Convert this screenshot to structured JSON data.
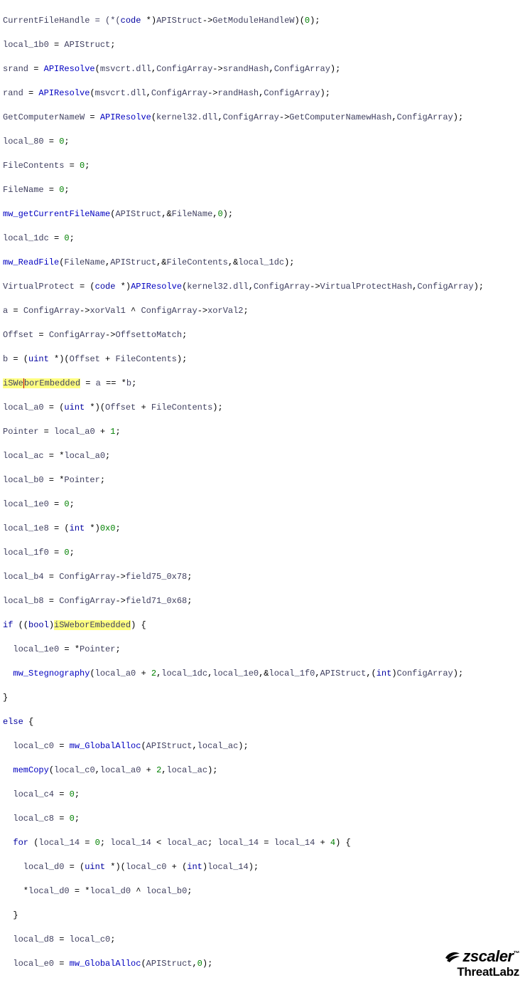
{
  "code": {
    "l1": {
      "a": "CurrentFileHandle = (*(",
      "b": "code",
      "c": " *)",
      "d": "APIStruct",
      "e": "->",
      "f": "GetModuleHandleW",
      "g": ")(",
      "h": "0",
      "i": ");"
    },
    "l2": {
      "a": "local_1b0",
      "b": " = ",
      "c": "APIStruct",
      "d": ";"
    },
    "l3": {
      "a": "srand",
      "b": " = ",
      "c": "APIResolve",
      "d": "(",
      "e": "msvcrt.dll",
      "f": ",",
      "g": "ConfigArray",
      "h": "->",
      "i": "srandHash",
      "j": ",",
      "k": "ConfigArray",
      "l": ");"
    },
    "l4": {
      "a": "rand",
      "b": " = ",
      "c": "APIResolve",
      "d": "(",
      "e": "msvcrt.dll",
      "f": ",",
      "g": "ConfigArray",
      "h": "->",
      "i": "randHash",
      "j": ",",
      "k": "ConfigArray",
      "l": ");"
    },
    "l5": {
      "a": "GetComputerNameW",
      "b": " = ",
      "c": "APIResolve",
      "d": "(",
      "e": "kernel32.dll",
      "f": ",",
      "g": "ConfigArray",
      "h": "->",
      "i": "GetComputerNamewHash",
      "j": ",",
      "k": "ConfigArray",
      "l": ");"
    },
    "l6": {
      "a": "local_80",
      "b": " = ",
      "c": "0",
      "d": ";"
    },
    "l7": {
      "a": "FileContents",
      "b": " = ",
      "c": "0",
      "d": ";"
    },
    "l8": {
      "a": "FileName",
      "b": " = ",
      "c": "0",
      "d": ";"
    },
    "l9": {
      "a": "mw_getCurrentFileName",
      "b": "(",
      "c": "APIStruct",
      "d": ",&",
      "e": "FileName",
      "f": ",",
      "g": "0",
      "h": ");"
    },
    "l10": {
      "a": "local_1dc",
      "b": " = ",
      "c": "0",
      "d": ";"
    },
    "l11": {
      "a": "mw_ReadFile",
      "b": "(",
      "c": "FileName",
      "d": ",",
      "e": "APIStruct",
      "f": ",&",
      "g": "FileContents",
      "h": ",&",
      "i": "local_1dc",
      "j": ");"
    },
    "l12": {
      "a": "VirtualProtect",
      "b": " = (",
      "c": "code",
      "d": " *)",
      "e": "APIResolve",
      "f": "(",
      "g": "kernel32.dll",
      "h": ",",
      "i": "ConfigArray",
      "j": "->",
      "k": "VirtualProtectHash",
      "l": ",",
      "m": "ConfigArray",
      "n": ");"
    },
    "l13": {
      "a": "a",
      "b": " = ",
      "c": "ConfigArray",
      "d": "->",
      "e": "xorVal1",
      "f": " ^ ",
      "g": "ConfigArray",
      "h": "->",
      "i": "xorVal2",
      "j": ";"
    },
    "l14": {
      "a": "Offset",
      "b": " = ",
      "c": "ConfigArray",
      "d": "->",
      "e": "OffsettoMatch",
      "f": ";"
    },
    "l15": {
      "a": "b",
      "b": " = (",
      "c": "uint",
      "d": " *)(",
      "e": "Offset",
      "f": " + ",
      "g": "FileContents",
      "h": ");"
    },
    "l16": {
      "a": "iSWe",
      "b": "borEmbedded",
      "c": " = ",
      "d": "a",
      "e": " == *",
      "f": "b",
      "g": ";"
    },
    "l17": {
      "a": "local_a0",
      "b": " = (",
      "c": "uint",
      "d": " *)(",
      "e": "Offset",
      "f": " + ",
      "g": "FileContents",
      "h": ");"
    },
    "l18": {
      "a": "Pointer",
      "b": " = ",
      "c": "local_a0",
      "d": " + ",
      "e": "1",
      "f": ";"
    },
    "l19": {
      "a": "local_ac",
      "b": " = *",
      "c": "local_a0",
      "d": ";"
    },
    "l20": {
      "a": "local_b0",
      "b": " = *",
      "c": "Pointer",
      "d": ";"
    },
    "l21": {
      "a": "local_1e0",
      "b": " = ",
      "c": "0",
      "d": ";"
    },
    "l22": {
      "a": "local_1e8",
      "b": " = (",
      "c": "int",
      "d": " *)",
      "e": "0x0",
      "f": ";"
    },
    "l23": {
      "a": "local_1f0",
      "b": " = ",
      "c": "0",
      "d": ";"
    },
    "l24": {
      "a": "local_b4",
      "b": " = ",
      "c": "ConfigArray",
      "d": "->",
      "e": "field75_0x78",
      "f": ";"
    },
    "l25": {
      "a": "local_b8",
      "b": " = ",
      "c": "ConfigArray",
      "d": "->",
      "e": "field71_0x68",
      "f": ";"
    },
    "l26": {
      "a": "if",
      "b": " ((",
      "c": "bool",
      "d": ")",
      "e": "iSWeborEmbedded",
      "f": ") {"
    },
    "l27": {
      "a": "  local_1e0",
      "b": " = *",
      "c": "Pointer",
      "d": ";"
    },
    "l28": {
      "a": "  ",
      "b": "mw_Stegnography",
      "c": "(",
      "d": "local_a0",
      "e": " + ",
      "f": "2",
      "g": ",",
      "h": "local_1dc",
      "i": ",",
      "j": "local_1e0",
      "k": ",&",
      "l": "local_1f0",
      "m": ",",
      "n": "APIStruct",
      "o": ",(",
      "p": "int",
      "q": ")",
      "r": "ConfigArray",
      "s": ");"
    },
    "l29": {
      "a": "}"
    },
    "l30": {
      "a": "else",
      "b": " {"
    },
    "l31": {
      "a": "  local_c0",
      "b": " = ",
      "c": "mw_GlobalAlloc",
      "d": "(",
      "e": "APIStruct",
      "f": ",",
      "g": "local_ac",
      "h": ");"
    },
    "l32": {
      "a": "  ",
      "b": "memCopy",
      "c": "(",
      "d": "local_c0",
      "e": ",",
      "f": "local_a0",
      "g": " + ",
      "h": "2",
      "i": ",",
      "j": "local_ac",
      "k": ");"
    },
    "l33": {
      "a": "  local_c4",
      "b": " = ",
      "c": "0",
      "d": ";"
    },
    "l34": {
      "a": "  local_c8",
      "b": " = ",
      "c": "0",
      "d": ";"
    },
    "l35": {
      "a": "  ",
      "b": "for",
      "c": " (",
      "d": "local_14",
      "e": " = ",
      "f": "0",
      "g": "; ",
      "h": "local_14",
      "i": " < ",
      "j": "local_ac",
      "k": "; ",
      "l": "local_14",
      "m": " = ",
      "n": "local_14",
      "o": " + ",
      "p": "4",
      "q": ") {"
    },
    "l36": {
      "a": "    local_d0",
      "b": " = (",
      "c": "uint",
      "d": " *)(",
      "e": "local_c0",
      "f": " + (",
      "g": "int",
      "h": ")",
      "i": "local_14",
      "j": ");"
    },
    "l37": {
      "a": "    *",
      "b": "local_d0",
      "c": " = *",
      "d": "local_d0",
      "e": " ^ ",
      "f": "local_b0",
      "g": ";"
    },
    "l38": {
      "a": "  }"
    },
    "l39": {
      "a": "  local_d8",
      "b": " = ",
      "c": "local_c0",
      "d": ";"
    },
    "l40": {
      "a": "  local_e0",
      "b": " = ",
      "c": "mw_GlobalAlloc",
      "d": "(",
      "e": "APIStruct",
      "f": ",",
      "g": "0",
      "h": ");"
    }
  },
  "brand": {
    "zscaler": "zscaler",
    "tm": "™",
    "threatlabz": "ThreatLabz"
  }
}
